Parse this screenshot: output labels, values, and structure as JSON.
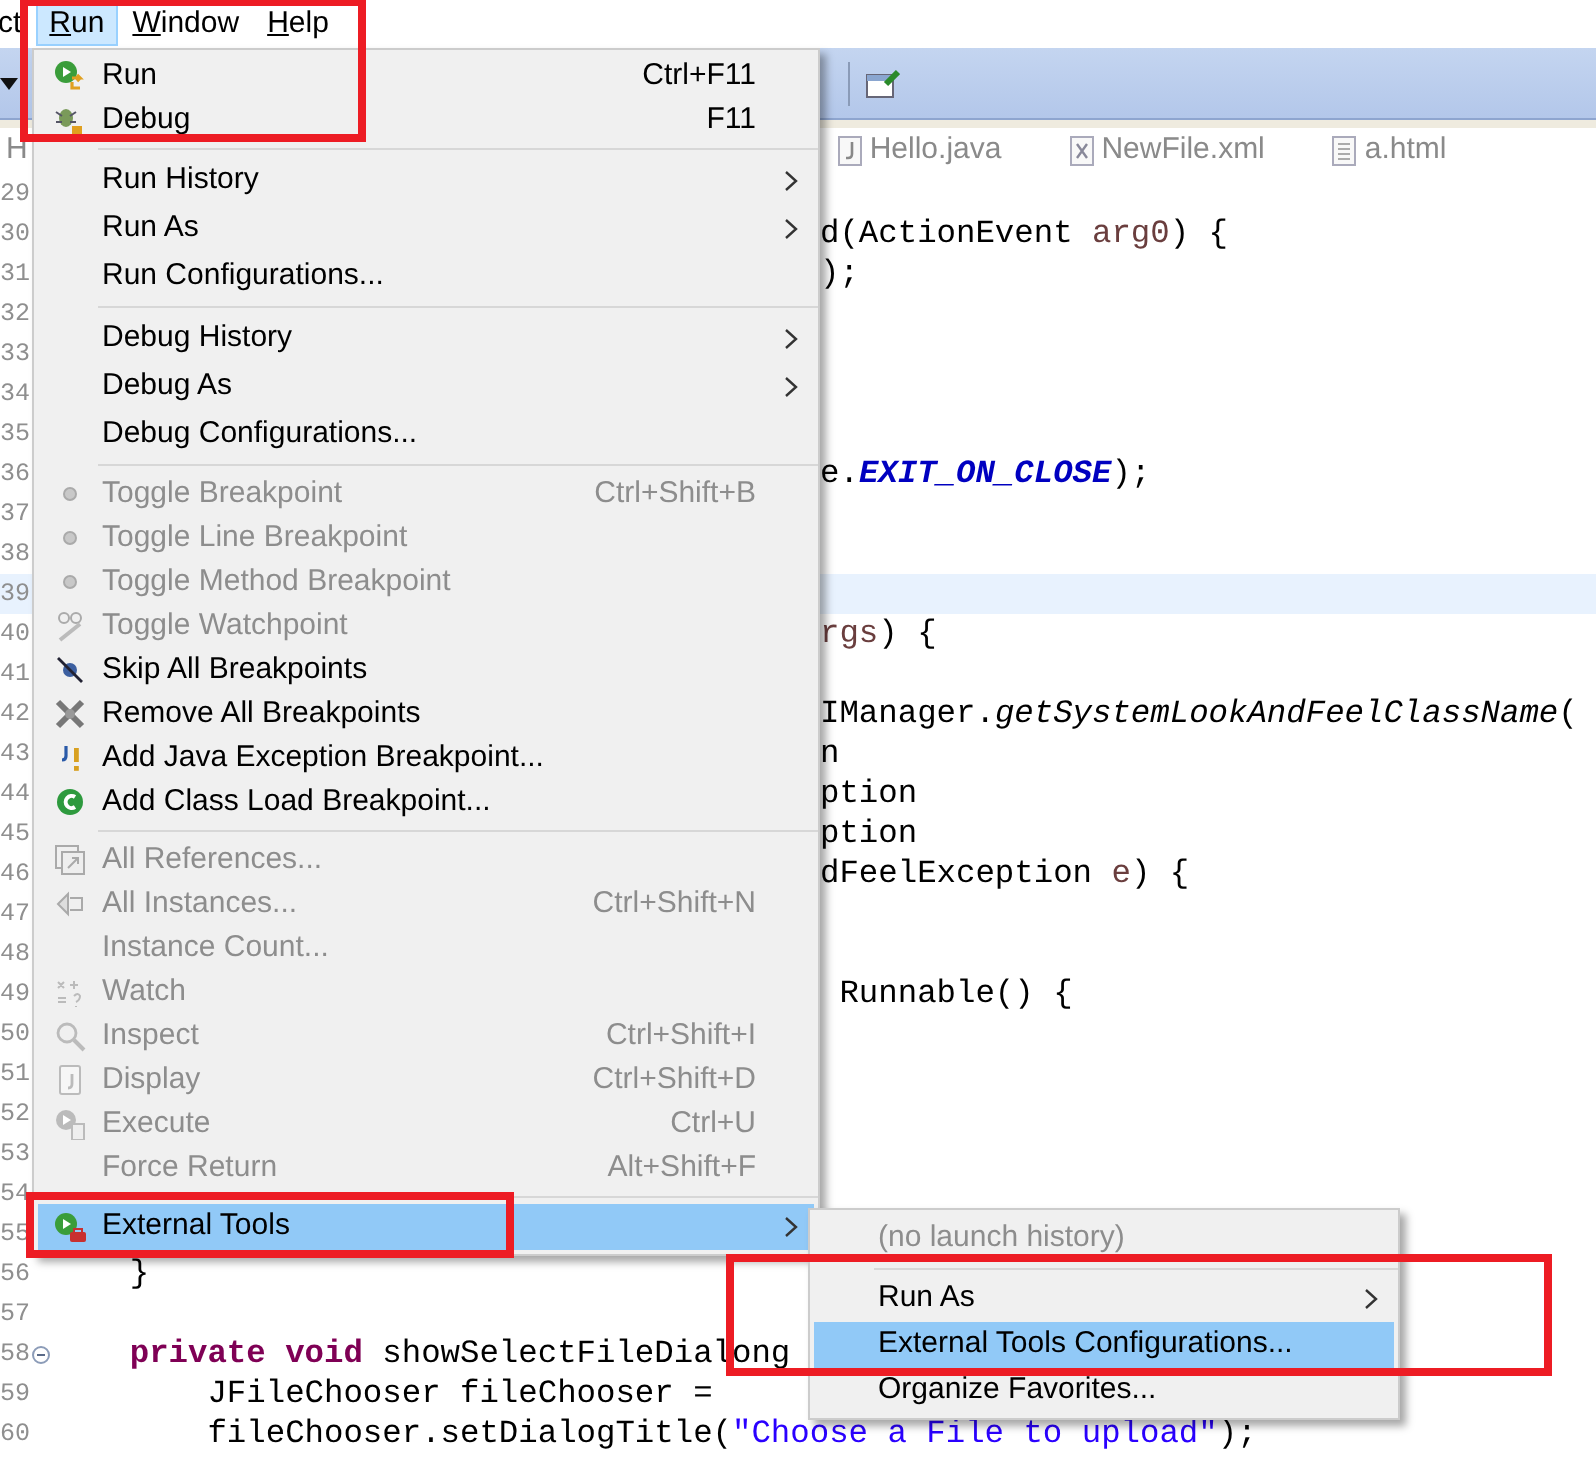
{
  "menu_bar": {
    "items": [
      {
        "label": "ct",
        "selected": false,
        "mnemonic": false
      },
      {
        "label": "Run",
        "selected": true,
        "mnemonic": true
      },
      {
        "label": "Window",
        "selected": false,
        "mnemonic": true
      },
      {
        "label": "Help",
        "selected": false,
        "mnemonic": true
      }
    ]
  },
  "editor_tabs": [
    {
      "label": "H",
      "kind": "cut"
    },
    {
      "label": "Hello.java",
      "kind": "java"
    },
    {
      "label": "NewFile.xml",
      "kind": "xml"
    },
    {
      "label": "a.html",
      "kind": "text"
    }
  ],
  "code_lines": [
    {
      "number": "29",
      "current": false
    },
    {
      "number": "30",
      "current": false,
      "clipped": true,
      "segments": [
        {
          "text": "d(ActionEvent ",
          "kind": "plain"
        },
        {
          "text": "arg0",
          "kind": "param"
        },
        {
          "text": ") {",
          "kind": "plain"
        }
      ]
    },
    {
      "number": "31",
      "current": false,
      "clipped": true,
      "segments": [
        {
          "text": ");",
          "kind": "plain"
        }
      ]
    },
    {
      "number": "32",
      "current": false
    },
    {
      "number": "33",
      "current": false
    },
    {
      "number": "34",
      "current": false
    },
    {
      "number": "35",
      "current": false
    },
    {
      "number": "36",
      "current": false,
      "clipped": true,
      "segments": [
        {
          "text": "e.",
          "kind": "plain"
        },
        {
          "text": "EXIT_ON_CLOSE",
          "kind": "constant"
        },
        {
          "text": ");",
          "kind": "plain"
        }
      ]
    },
    {
      "number": "37",
      "current": false
    },
    {
      "number": "38",
      "current": false
    },
    {
      "number": "39",
      "current": true
    },
    {
      "number": "40",
      "current": false,
      "clipped": true,
      "segments": [
        {
          "text": "rgs",
          "kind": "param"
        },
        {
          "text": ") {",
          "kind": "plain"
        }
      ]
    },
    {
      "number": "41",
      "current": false
    },
    {
      "number": "42",
      "current": false,
      "clipped": true,
      "segments": [
        {
          "text": "IManager.",
          "kind": "plain"
        },
        {
          "text": "getSystemLookAndFeelClassName",
          "kind": "static"
        },
        {
          "text": "(",
          "kind": "plain"
        }
      ]
    },
    {
      "number": "43",
      "current": false,
      "clipped": true,
      "segments": [
        {
          "text": "n",
          "kind": "plain"
        }
      ]
    },
    {
      "number": "44",
      "current": false,
      "clipped": true,
      "segments": [
        {
          "text": "ption",
          "kind": "plain"
        }
      ]
    },
    {
      "number": "45",
      "current": false,
      "clipped": true,
      "segments": [
        {
          "text": "ption",
          "kind": "plain"
        }
      ]
    },
    {
      "number": "46",
      "current": false,
      "clipped": true,
      "segments": [
        {
          "text": "dFeelException ",
          "kind": "plain"
        },
        {
          "text": "e",
          "kind": "param"
        },
        {
          "text": ") {",
          "kind": "plain"
        }
      ]
    },
    {
      "number": "47",
      "current": false
    },
    {
      "number": "48",
      "current": false
    },
    {
      "number": "49",
      "current": false,
      "clipped": true,
      "segments": [
        {
          "text": " Runnable() {",
          "kind": "plain"
        }
      ]
    },
    {
      "number": "50",
      "current": false
    },
    {
      "number": "51",
      "current": false
    },
    {
      "number": "52",
      "current": false
    },
    {
      "number": "53",
      "current": false
    },
    {
      "number": "54",
      "current": false
    },
    {
      "number": "55",
      "current": false
    },
    {
      "number": "56",
      "current": false,
      "clipped": false,
      "segments": [
        {
          "text": "    }",
          "kind": "plain"
        }
      ]
    },
    {
      "number": "57",
      "current": false
    },
    {
      "number": "58",
      "current": false,
      "foldable": true,
      "clipped": false,
      "segments": [
        {
          "text": "    private void",
          "kind": "keyword"
        },
        {
          "text": " showSelectFileDialong",
          "kind": "plain"
        }
      ]
    },
    {
      "number": "59",
      "current": false,
      "clipped": false,
      "segments": [
        {
          "text": "        JFileChooser fileChooser =",
          "kind": "plain"
        }
      ]
    },
    {
      "number": "60",
      "current": false,
      "clipped": false,
      "segments": [
        {
          "text": "        fileChooser.setDialogTitle(",
          "kind": "plain"
        },
        {
          "text": "\"Choose a File to upload\"",
          "kind": "string"
        },
        {
          "text": ");",
          "kind": "plain"
        }
      ]
    }
  ],
  "run_menu": {
    "sections": [
      {
        "items": [
          {
            "label": "Run",
            "shortcut": "Ctrl+F11",
            "kind": "run",
            "disabled": false,
            "selected": false,
            "submenu": false
          },
          {
            "label": "Debug",
            "shortcut": "F11",
            "kind": "debug",
            "disabled": false,
            "selected": false,
            "submenu": false
          }
        ]
      },
      {
        "items": [
          {
            "label": "Run History",
            "kind": "plain",
            "disabled": false,
            "selected": false,
            "submenu": true
          },
          {
            "label": "Run As",
            "kind": "plain",
            "disabled": false,
            "selected": false,
            "submenu": true
          },
          {
            "label": "Run Configurations...",
            "kind": "plain",
            "disabled": false,
            "selected": false,
            "submenu": false
          }
        ]
      },
      {
        "items": [
          {
            "label": "Debug History",
            "kind": "plain",
            "disabled": false,
            "selected": false,
            "submenu": true
          },
          {
            "label": "Debug As",
            "kind": "plain",
            "disabled": false,
            "selected": false,
            "submenu": true
          },
          {
            "label": "Debug Configurations...",
            "kind": "plain",
            "disabled": false,
            "selected": false,
            "submenu": false
          }
        ]
      },
      {
        "items": [
          {
            "label": "Toggle Breakpoint",
            "shortcut": "Ctrl+Shift+B",
            "kind": "breakpoint",
            "disabled": true,
            "selected": false,
            "submenu": false
          },
          {
            "label": "Toggle Line Breakpoint",
            "kind": "breakpoint",
            "disabled": true,
            "selected": false,
            "submenu": false
          },
          {
            "label": "Toggle Method Breakpoint",
            "kind": "breakpoint",
            "disabled": true,
            "selected": false,
            "submenu": false
          },
          {
            "label": "Toggle Watchpoint",
            "kind": "watchpoint",
            "disabled": true,
            "selected": false,
            "submenu": false
          },
          {
            "label": "Skip All Breakpoints",
            "kind": "skip",
            "disabled": false,
            "selected": false,
            "submenu": false
          },
          {
            "label": "Remove All Breakpoints",
            "kind": "remove",
            "disabled": false,
            "selected": false,
            "submenu": false
          },
          {
            "label": "Add Java Exception Breakpoint...",
            "kind": "exception",
            "disabled": false,
            "selected": false,
            "submenu": false
          },
          {
            "label": "Add Class Load Breakpoint...",
            "kind": "classload",
            "disabled": false,
            "selected": false,
            "submenu": false
          }
        ]
      },
      {
        "items": [
          {
            "label": "All References...",
            "kind": "references",
            "disabled": true,
            "selected": false,
            "submenu": false
          },
          {
            "label": "All Instances...",
            "shortcut": "Ctrl+Shift+N",
            "kind": "instances",
            "disabled": true,
            "selected": false,
            "submenu": false
          },
          {
            "label": "Instance Count...",
            "kind": "plain",
            "disabled": true,
            "selected": false,
            "submenu": false
          },
          {
            "label": "Watch",
            "kind": "watch",
            "disabled": true,
            "selected": false,
            "submenu": false
          },
          {
            "label": "Inspect",
            "shortcut": "Ctrl+Shift+I",
            "kind": "inspect",
            "disabled": true,
            "selected": false,
            "submenu": false
          },
          {
            "label": "Display",
            "shortcut": "Ctrl+Shift+D",
            "kind": "display",
            "disabled": true,
            "selected": false,
            "submenu": false
          },
          {
            "label": "Execute",
            "shortcut": "Ctrl+U",
            "kind": "execute",
            "disabled": true,
            "selected": false,
            "submenu": false
          },
          {
            "label": "Force Return",
            "shortcut": "Alt+Shift+F",
            "kind": "plain",
            "disabled": true,
            "selected": false,
            "submenu": false
          }
        ]
      },
      {
        "items": [
          {
            "label": "External Tools",
            "kind": "tools",
            "disabled": false,
            "selected": true,
            "submenu": true
          }
        ]
      }
    ]
  },
  "external_tools_menu": {
    "sections": [
      {
        "items": [
          {
            "label": "(no launch history)",
            "disabled": true,
            "selected": false,
            "submenu": false
          }
        ]
      },
      {
        "items": [
          {
            "label": "Run As",
            "disabled": false,
            "selected": false,
            "submenu": true
          },
          {
            "label": "External Tools Configurations...",
            "disabled": false,
            "selected": true,
            "submenu": false
          },
          {
            "label": "Organize Favorites...",
            "disabled": false,
            "selected": false,
            "submenu": false
          }
        ]
      }
    ]
  }
}
